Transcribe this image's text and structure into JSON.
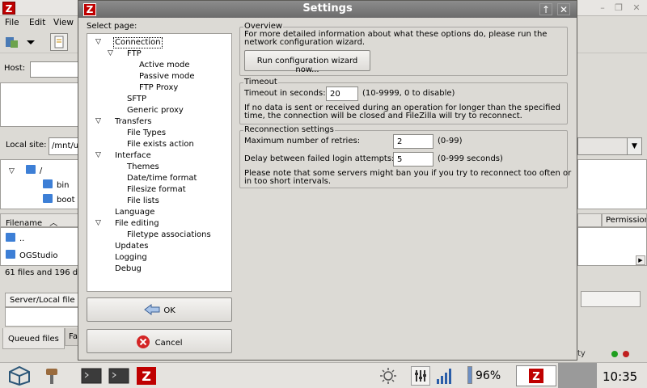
{
  "background_app": {
    "menu": [
      "File",
      "Edit",
      "View"
    ],
    "host_label": "Host:",
    "local_site_label": "Local site:",
    "local_site_value": "/mnt/u",
    "local_tree": [
      "/",
      "bin",
      "boot"
    ],
    "filename_header": "Filename",
    "files": [
      "..",
      "OGStudio"
    ],
    "status_text": "61 files and 196 d",
    "queue_header": "Server/Local file",
    "queued_files_tab": "Queued files",
    "failed_tab": "Fa",
    "permissions_header": "Permission",
    "right_status_text": "ty"
  },
  "dialog": {
    "title": "Settings",
    "select_page_label": "Select page:",
    "tree": [
      {
        "label": "Connection",
        "level": 0,
        "expanded": true,
        "selected": true
      },
      {
        "label": "FTP",
        "level": 1,
        "expanded": true
      },
      {
        "label": "Active mode",
        "level": 2
      },
      {
        "label": "Passive mode",
        "level": 2
      },
      {
        "label": "FTP Proxy",
        "level": 2
      },
      {
        "label": "SFTP",
        "level": 1
      },
      {
        "label": "Generic proxy",
        "level": 1
      },
      {
        "label": "Transfers",
        "level": 0,
        "expanded": true
      },
      {
        "label": "File Types",
        "level": 1
      },
      {
        "label": "File exists action",
        "level": 1
      },
      {
        "label": "Interface",
        "level": 0,
        "expanded": true
      },
      {
        "label": "Themes",
        "level": 1
      },
      {
        "label": "Date/time format",
        "level": 1
      },
      {
        "label": "Filesize format",
        "level": 1
      },
      {
        "label": "File lists",
        "level": 1
      },
      {
        "label": "Language",
        "level": 0
      },
      {
        "label": "File editing",
        "level": 0,
        "expanded": true
      },
      {
        "label": "Filetype associations",
        "level": 1
      },
      {
        "label": "Updates",
        "level": 0
      },
      {
        "label": "Logging",
        "level": 0
      },
      {
        "label": "Debug",
        "level": 0
      }
    ],
    "ok_label": "OK",
    "cancel_label": "Cancel",
    "overview": {
      "title": "Overview",
      "text_line1": "For more detailed information about what these options do, please run the",
      "text_line2": "network configuration wizard.",
      "wizard_button": "Run configuration wizard now..."
    },
    "timeout": {
      "title": "Timeout",
      "label": "Timeout in seconds:",
      "value": "20",
      "hint": "(10-9999, 0 to disable)",
      "note_line1": "If no data is sent or received during an operation for longer than the specified",
      "note_line2": "time, the connection will be closed and FileZilla will try to reconnect."
    },
    "reconnection": {
      "title": "Reconnection settings",
      "retries_label": "Maximum number of retries:",
      "retries_value": "2",
      "retries_hint": "(0-99)",
      "delay_label": "Delay between failed login attempts:",
      "delay_value": "5",
      "delay_hint": "(0-999 seconds)",
      "note_line1": "Please note that some servers might ban you if you try to reconnect too often or",
      "note_line2": "in too short intervals."
    }
  },
  "taskbar": {
    "battery": "96%",
    "clock": "10:35"
  }
}
